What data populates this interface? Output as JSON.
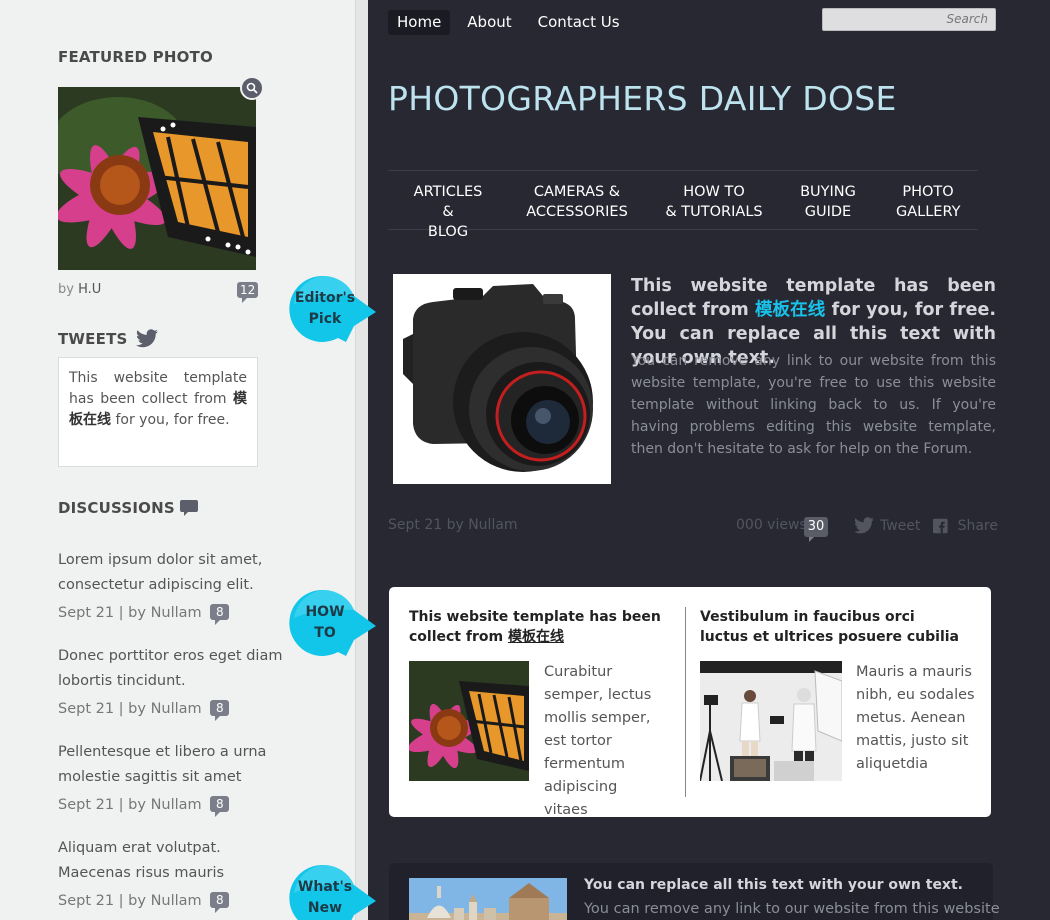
{
  "sidebar": {
    "featured_heading": "FEATURED PHOTO",
    "byline_prefix": "by",
    "byline_author": "H.U",
    "featured_comments": "12",
    "tweets_heading": "TWEETS",
    "tweet_text_before": "This website template has been collect from",
    "tweet_text_highlight": "模板在线",
    "tweet_text_after": "for you, for free.",
    "discussions_heading": "DISCUSSIONS",
    "discussions": [
      {
        "line1": "Lorem ipsum dolor sit amet,",
        "line2": "consectetur adipiscing elit.",
        "meta": "Sept 21 | by Nullam",
        "count": "8"
      },
      {
        "line1": "Donec porttitor eros eget diam",
        "line2": "lobortis tincidunt.",
        "meta": "Sept 21 | by Nullam",
        "count": "8"
      },
      {
        "line1": "Pellentesque et libero a urna",
        "line2": "molestie sagittis sit amet",
        "meta": "Sept 21 | by Nullam",
        "count": "8"
      },
      {
        "line1": "Aliquam erat volutpat.",
        "line2": "Maecenas risus mauris",
        "meta": "Sept 21 | by Nullam",
        "count": "8"
      }
    ]
  },
  "topnav": {
    "items": [
      "Home",
      "About",
      "Contact Us"
    ],
    "search_placeholder": "Search"
  },
  "site_title": "PHOTOGRAPHERS DAILY DOSE",
  "catnav": [
    {
      "l1": "ARTICLES &",
      "l2": "BLOG"
    },
    {
      "l1": "CAMERAS &",
      "l2": "ACCESSORIES"
    },
    {
      "l1": "HOW TO",
      "l2": "& TUTORIALS"
    },
    {
      "l1": "BUYING",
      "l2": "GUIDE"
    },
    {
      "l1": "PHOTO",
      "l2": "GALLERY"
    }
  ],
  "badges": {
    "editors_pick": [
      "Editor's",
      "Pick"
    ],
    "how_to": [
      "HOW",
      "TO"
    ],
    "whats_new": [
      "What's",
      "New"
    ]
  },
  "editors_pick": {
    "title_before": "This website template has been collect from",
    "title_highlight": "模板在线",
    "title_after": "for you, for free. You can replace all this text with your own text.",
    "description": "You can remove any link to our website from this website template, you're free to use this website template without linking back to us. If you're having problems editing this website template, then don't hesitate to ask for help on the Forum.",
    "meta_date": "Sept 21 by Nullam",
    "views_label": "000 views",
    "comments": "30",
    "tweet_label": "Tweet",
    "share_label": "Share"
  },
  "how_to": {
    "left_title_before": "This website template has been collect from",
    "left_title_link": "模板在线",
    "left_text": [
      "Curabitur",
      "semper, lectus",
      "mollis semper,",
      "est tortor",
      "fermentum",
      "adipiscing vitaes"
    ],
    "right_title": "Vestibulum in faucibus orci luctus et ultrices posuere cubilia",
    "right_text": [
      "Mauris a mauris",
      "nibh, eu sodales",
      "metus. Aenean",
      "mattis, justo sit",
      "aliquetdia"
    ]
  },
  "whats_new": {
    "title": "You can replace all this text with your own text.",
    "description": "You can remove any link to our website from this website"
  },
  "colors": {
    "main_bg": "#272832",
    "sidebar_bg": "#f0f1f1",
    "accent": "#19c2ea",
    "title": "#bde3ef"
  }
}
